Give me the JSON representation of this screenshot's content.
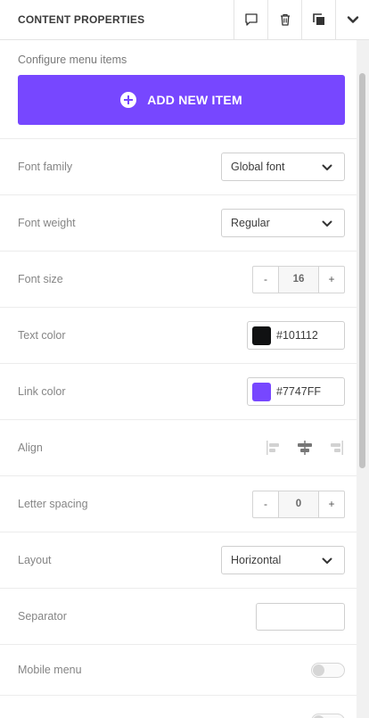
{
  "header": {
    "title": "CONTENT PROPERTIES"
  },
  "menu_items": {
    "label": "Configure menu items",
    "add_button": "ADD NEW ITEM"
  },
  "font_family": {
    "label": "Font family",
    "value": "Global font"
  },
  "font_weight": {
    "label": "Font weight",
    "value": "Regular"
  },
  "font_size": {
    "label": "Font size",
    "decrement": "-",
    "value": "16",
    "increment": "+"
  },
  "text_color": {
    "label": "Text color",
    "value": "#101112",
    "swatch": "#101112"
  },
  "link_color": {
    "label": "Link color",
    "value": "#7747FF",
    "swatch": "#7747FF"
  },
  "align": {
    "label": "Align",
    "options": [
      "align-left-icon",
      "align-center-icon",
      "align-right-icon"
    ],
    "selected": "center"
  },
  "letter_spacing": {
    "label": "Letter spacing",
    "decrement": "-",
    "value": "0",
    "increment": "+"
  },
  "layout": {
    "label": "Layout",
    "value": "Horizontal"
  },
  "separator": {
    "label": "Separator",
    "value": ""
  },
  "mobile_menu": {
    "label": "Mobile menu",
    "enabled": false
  },
  "colors": {
    "accent": "#7747FF"
  }
}
